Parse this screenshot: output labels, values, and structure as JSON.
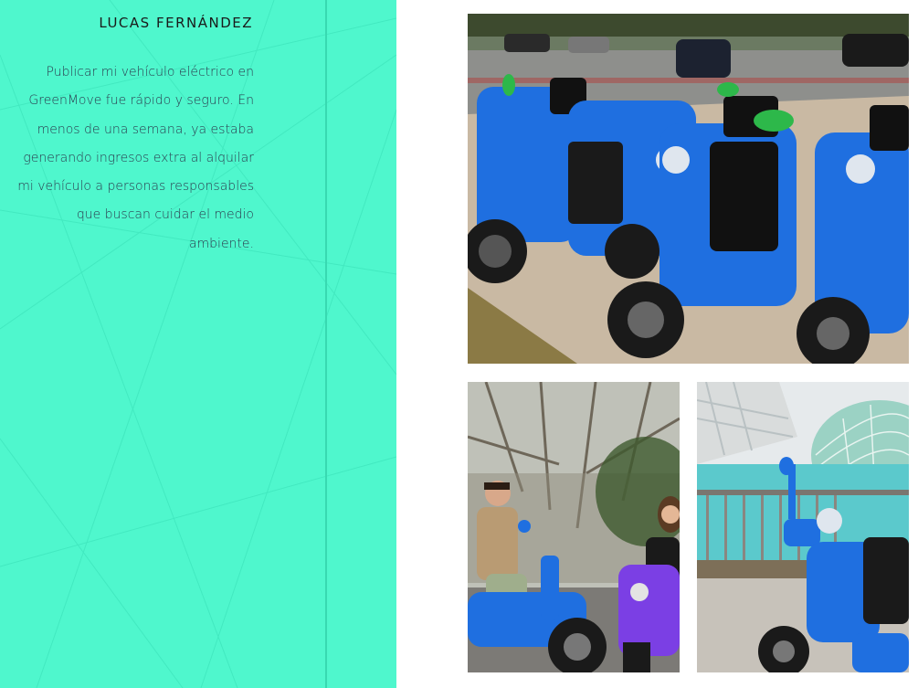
{
  "testimonial": {
    "author": "LUCAS FERNÁNDEZ",
    "quote_lines": [
      "Publicar mi vehículo eléctrico en",
      "GreenMove fue rápido y seguro. En",
      "menos de una semana, ya estaba",
      "generando ingresos extra al alquilar",
      "mi vehículo a personas responsables",
      "que buscan cuidar el medio ambiente."
    ]
  },
  "colors": {
    "panel_bg": "#4ff7cd",
    "panel_line": "#38d9b1",
    "scooter_blue": "#1f6fe0",
    "scooter_purple": "#7b3fe4"
  },
  "gallery": {
    "photo_main_icon": "scooter-fleet-photo",
    "photo_people_icon": "riders-photo",
    "photo_city_icon": "city-scooter-photo"
  }
}
